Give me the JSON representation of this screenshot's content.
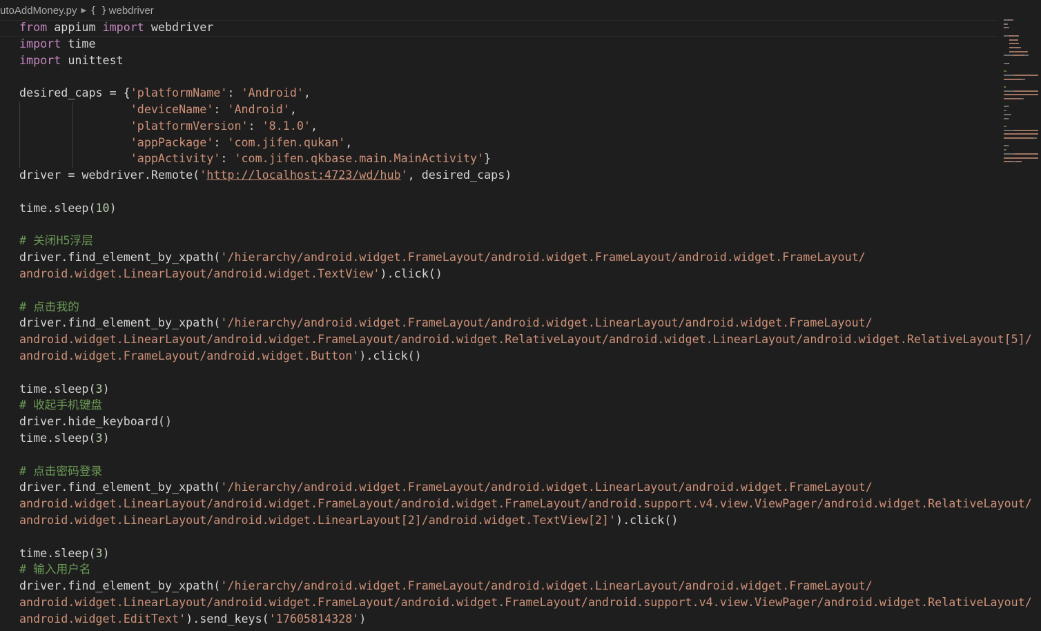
{
  "breadcrumb": {
    "file": "utoAddMoney.py",
    "symbol_icon": "{ }",
    "symbol": "webdriver"
  },
  "code": [
    [
      [
        "from",
        "kw"
      ],
      [
        " appium ",
        ""
      ],
      [
        "import",
        "kw"
      ],
      [
        " webdriver",
        ""
      ]
    ],
    [
      [
        "import",
        "kw"
      ],
      [
        " time",
        ""
      ]
    ],
    [
      [
        "import",
        "kw"
      ],
      [
        " unittest",
        ""
      ]
    ],
    [],
    [
      [
        "desired_caps = {",
        ""
      ],
      [
        "'platformName'",
        "str"
      ],
      [
        ": ",
        ""
      ],
      [
        "'Android'",
        "str"
      ],
      [
        ",",
        ""
      ]
    ],
    [
      [
        "                ",
        ""
      ],
      [
        "'deviceName'",
        "str"
      ],
      [
        ": ",
        ""
      ],
      [
        "'Android'",
        "str"
      ],
      [
        ",",
        ""
      ]
    ],
    [
      [
        "                ",
        ""
      ],
      [
        "'platformVersion'",
        "str"
      ],
      [
        ": ",
        ""
      ],
      [
        "'8.1.0'",
        "str"
      ],
      [
        ",",
        ""
      ]
    ],
    [
      [
        "                ",
        ""
      ],
      [
        "'appPackage'",
        "str"
      ],
      [
        ": ",
        ""
      ],
      [
        "'com.jifen.qukan'",
        "str"
      ],
      [
        ",",
        ""
      ]
    ],
    [
      [
        "                ",
        ""
      ],
      [
        "'appActivity'",
        "str"
      ],
      [
        ": ",
        ""
      ],
      [
        "'com.jifen.qkbase.main.MainActivity'",
        "str"
      ],
      [
        "}",
        ""
      ]
    ],
    [
      [
        "driver = webdriver.Remote(",
        ""
      ],
      [
        "'",
        "str"
      ],
      [
        "http://localhost:4723/wd/hub",
        "str url"
      ],
      [
        "'",
        "str"
      ],
      [
        ", desired_caps)",
        ""
      ]
    ],
    [],
    [
      [
        "time.sleep(",
        ""
      ],
      [
        "10",
        "num"
      ],
      [
        ")",
        ""
      ]
    ],
    [],
    [
      [
        "# 关闭H5浮层",
        "cmt"
      ]
    ],
    [
      [
        "driver.find_element_by_xpath(",
        ""
      ],
      [
        "'/hierarchy/android.widget.FrameLayout/android.widget.FrameLayout/android.widget.FrameLayout/",
        "str"
      ]
    ],
    [
      [
        "android.widget.LinearLayout/android.widget.TextView'",
        "str"
      ],
      [
        ").click()",
        ""
      ]
    ],
    [],
    [
      [
        "# 点击我的",
        "cmt"
      ]
    ],
    [
      [
        "driver.find_element_by_xpath(",
        ""
      ],
      [
        "'/hierarchy/android.widget.FrameLayout/android.widget.LinearLayout/android.widget.FrameLayout/",
        "str"
      ]
    ],
    [
      [
        "android.widget.LinearLayout/android.widget.FrameLayout/android.widget.RelativeLayout/android.widget.LinearLayout/android.widget.RelativeLayout[5]/",
        "str"
      ]
    ],
    [
      [
        "android.widget.FrameLayout/android.widget.Button'",
        "str"
      ],
      [
        ").click()",
        ""
      ]
    ],
    [],
    [
      [
        "time.sleep(",
        ""
      ],
      [
        "3",
        "num"
      ],
      [
        ")",
        ""
      ]
    ],
    [
      [
        "# 收起手机键盘",
        "cmt"
      ]
    ],
    [
      [
        "driver.hide_keyboard()",
        ""
      ]
    ],
    [
      [
        "time.sleep(",
        ""
      ],
      [
        "3",
        "num"
      ],
      [
        ")",
        ""
      ]
    ],
    [],
    [
      [
        "# 点击密码登录",
        "cmt"
      ]
    ],
    [
      [
        "driver.find_element_by_xpath(",
        ""
      ],
      [
        "'/hierarchy/android.widget.FrameLayout/android.widget.LinearLayout/android.widget.FrameLayout/",
        "str"
      ]
    ],
    [
      [
        "android.widget.LinearLayout/android.widget.FrameLayout/android.widget.FrameLayout/android.support.v4.view.ViewPager/android.widget.RelativeLayout/",
        "str"
      ]
    ],
    [
      [
        "android.widget.LinearLayout/android.widget.LinearLayout[2]/android.widget.TextView[2]'",
        "str"
      ],
      [
        ").click()",
        ""
      ]
    ],
    [],
    [
      [
        "time.sleep(",
        ""
      ],
      [
        "3",
        "num"
      ],
      [
        ")",
        ""
      ]
    ],
    [
      [
        "# 输入用户名",
        "cmt"
      ]
    ],
    [
      [
        "driver.find_element_by_xpath(",
        ""
      ],
      [
        "'/hierarchy/android.widget.FrameLayout/android.widget.LinearLayout/android.widget.FrameLayout/",
        "str"
      ]
    ],
    [
      [
        "android.widget.LinearLayout/android.widget.FrameLayout/android.widget.FrameLayout/android.support.v4.view.ViewPager/android.widget.RelativeLayout/",
        "str"
      ]
    ],
    [
      [
        "android.widget.EditText'",
        "str"
      ],
      [
        ").send_keys(",
        ""
      ],
      [
        "'17605814328'",
        "str"
      ],
      [
        ")",
        ""
      ]
    ]
  ],
  "colors": {
    "background": "#1e1e1e",
    "keyword": "#c586c0",
    "string": "#ce9178",
    "number": "#b5cea8",
    "comment": "#6a9955",
    "text": "#d4d4d4"
  }
}
